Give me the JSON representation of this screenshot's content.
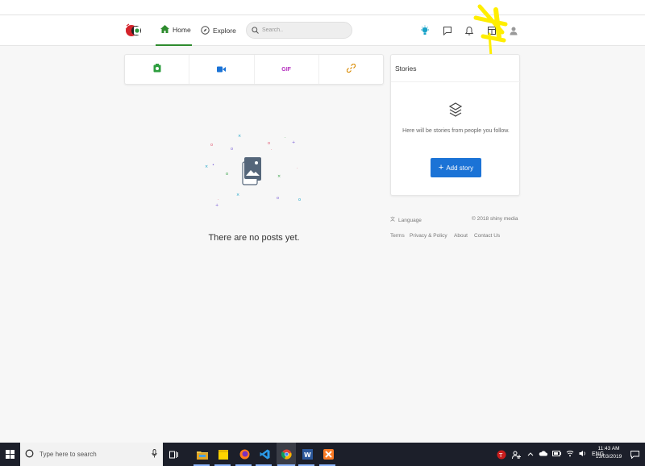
{
  "header": {
    "nav": {
      "home_label": "Home",
      "explore_label": "Explore"
    },
    "search": {
      "placeholder": "Search.."
    },
    "colors": {
      "accent_green": "#2e8b2e",
      "bulb": "#1aa3c8"
    }
  },
  "composer": {
    "buttons": [
      {
        "name": "photo",
        "icon": "camera-icon",
        "color": "#2e9e3f"
      },
      {
        "name": "video",
        "icon": "video-camera-icon",
        "color": "#1b73d6"
      },
      {
        "name": "gif",
        "label": "GIF",
        "color": "#b52fbf"
      },
      {
        "name": "link",
        "icon": "link-icon",
        "color": "#d98a00"
      }
    ]
  },
  "feed": {
    "empty_message": "There are no posts yet."
  },
  "stories": {
    "title": "Stories",
    "empty_message": "Here will be stories from people you follow.",
    "add_button_label": "Add story",
    "button_color": "#1b73d6"
  },
  "footer": {
    "language": "Language",
    "copyright": "© 2018 shiny media",
    "links": [
      "Terms",
      "Privacy & Policy",
      "About",
      "Contact Us"
    ]
  },
  "taskbar": {
    "search_placeholder": "Type here to search",
    "language": "ENG",
    "time": "11:43 AM",
    "date": "13/03/2019"
  }
}
